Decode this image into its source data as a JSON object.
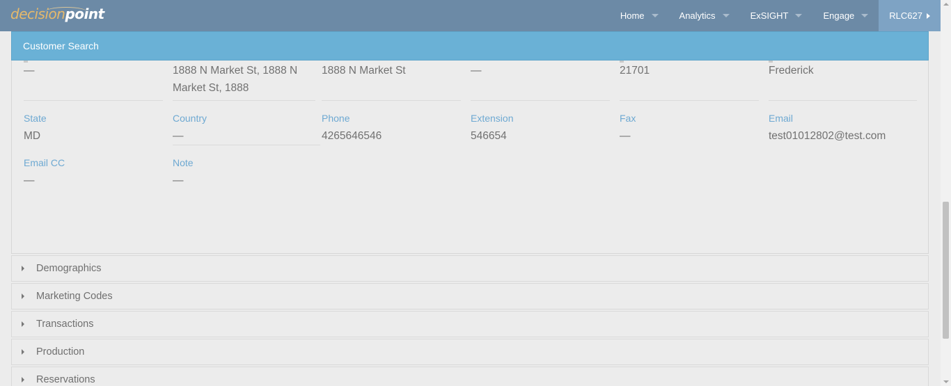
{
  "app": {
    "logo_part1": "decision",
    "logo_part2": "point"
  },
  "nav": {
    "items": [
      {
        "label": "Home"
      },
      {
        "label": "Analytics"
      },
      {
        "label": "ExSIGHT"
      },
      {
        "label": "Engage"
      },
      {
        "label": "RLC627"
      }
    ]
  },
  "customer_search": {
    "title": "Customer Search"
  },
  "details": {
    "row1": [
      {
        "value": "—"
      },
      {
        "value": "1888 N Market St, 1888 N Market St, 1888"
      },
      {
        "value": "1888 N Market St"
      },
      {
        "value": "—"
      },
      {
        "value": "21701"
      },
      {
        "value": "Frederick"
      }
    ],
    "row2": [
      {
        "label": "State",
        "value": "MD"
      },
      {
        "label": "Country",
        "value": "—"
      },
      {
        "label": "Phone",
        "value": "4265646546"
      },
      {
        "label": "Extension",
        "value": "546654"
      },
      {
        "label": "Fax",
        "value": "—"
      },
      {
        "label": "Email",
        "value": "test01012802@test.com"
      }
    ],
    "row3": [
      {
        "label": "Email CC",
        "value": "—"
      },
      {
        "label": "Note",
        "value": "—"
      }
    ]
  },
  "sections": [
    {
      "label": "Demographics"
    },
    {
      "label": "Marketing Codes"
    },
    {
      "label": "Transactions"
    },
    {
      "label": "Production"
    },
    {
      "label": "Reservations"
    }
  ],
  "colors": {
    "topbar": "#6c8aa6",
    "search_header": "#6ab1d6",
    "label_blue": "#6ea9d2",
    "logo_gold": "#e6b96b"
  }
}
